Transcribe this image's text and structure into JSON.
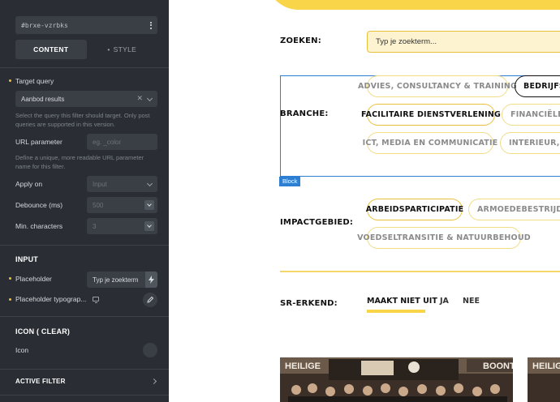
{
  "panel": {
    "element_id": "#brxe-vzrbks",
    "tabs": {
      "content": "CONTENT",
      "style": "STYLE"
    },
    "target_query": {
      "label": "Target query",
      "value": "Aanbod results",
      "help": "Select the query this filter should target. Only post queries are supported in this version."
    },
    "url_parameter": {
      "label": "URL parameter",
      "placeholder": "eg. _color",
      "help": "Define a unique, more readable URL parameter name for this filter."
    },
    "apply_on": {
      "label": "Apply on",
      "value": "Input"
    },
    "debounce": {
      "label": "Debounce (ms)",
      "value": "500",
      "spin": "v"
    },
    "min_chars": {
      "label": "Min. characters",
      "value": "3",
      "spin": "v"
    },
    "input_section": {
      "title": "INPUT",
      "placeholder_label": "Placeholder",
      "placeholder_value": "Typ je zoekterm",
      "typography_label": "Placeholder typograp..."
    },
    "icon_section": {
      "title": "ICON ( CLEAR)",
      "icon_label": "Icon"
    },
    "active_filter": "ACTIVE FILTER",
    "icons": [
      "kebab-icon",
      "close-icon",
      "chevron-down-icon",
      "bolt-icon",
      "monitor-icon",
      "pencil-icon",
      "chevron-right-icon"
    ],
    "accent_color": "#e8c13a"
  },
  "canvas": {
    "search": {
      "label": "ZOEKEN:",
      "placeholder": "Typ je zoekterm..."
    },
    "branche": {
      "label": "BRANCHE:",
      "chips": [
        {
          "text": "ADVIES, CONSULTANCY & TRAINING",
          "state": "off"
        },
        {
          "text": "BEDRIJFSU",
          "state": "strong"
        },
        {
          "text": "FACILITAIRE DIENSTVERLENING",
          "state": "on"
        },
        {
          "text": "FINANCIËLE DI",
          "state": "off"
        },
        {
          "text": "ICT, MEDIA EN COMMUNICATIE",
          "state": "off"
        },
        {
          "text": "INTERIEUR, MO",
          "state": "off"
        }
      ]
    },
    "block_tag": "Block",
    "impact": {
      "label": "IMPACTGEBIED:",
      "chips": [
        {
          "text": "ARBEIDSPARTICIPATIE",
          "state": "on"
        },
        {
          "text": "ARMOEDEBESTRIJDING",
          "state": "off"
        },
        {
          "text": "VOEDSELTRANSITIE & NATUURBEHOUD",
          "state": "off"
        }
      ]
    },
    "sr": {
      "label": "SR-ERKEND:",
      "options": [
        "MAAKT NIET UIT",
        "JA",
        "NEE"
      ]
    },
    "photo_signs": [
      "HEILIGE",
      "BOONT",
      "HEILIGE"
    ],
    "accent_color": "#f9d54a"
  }
}
